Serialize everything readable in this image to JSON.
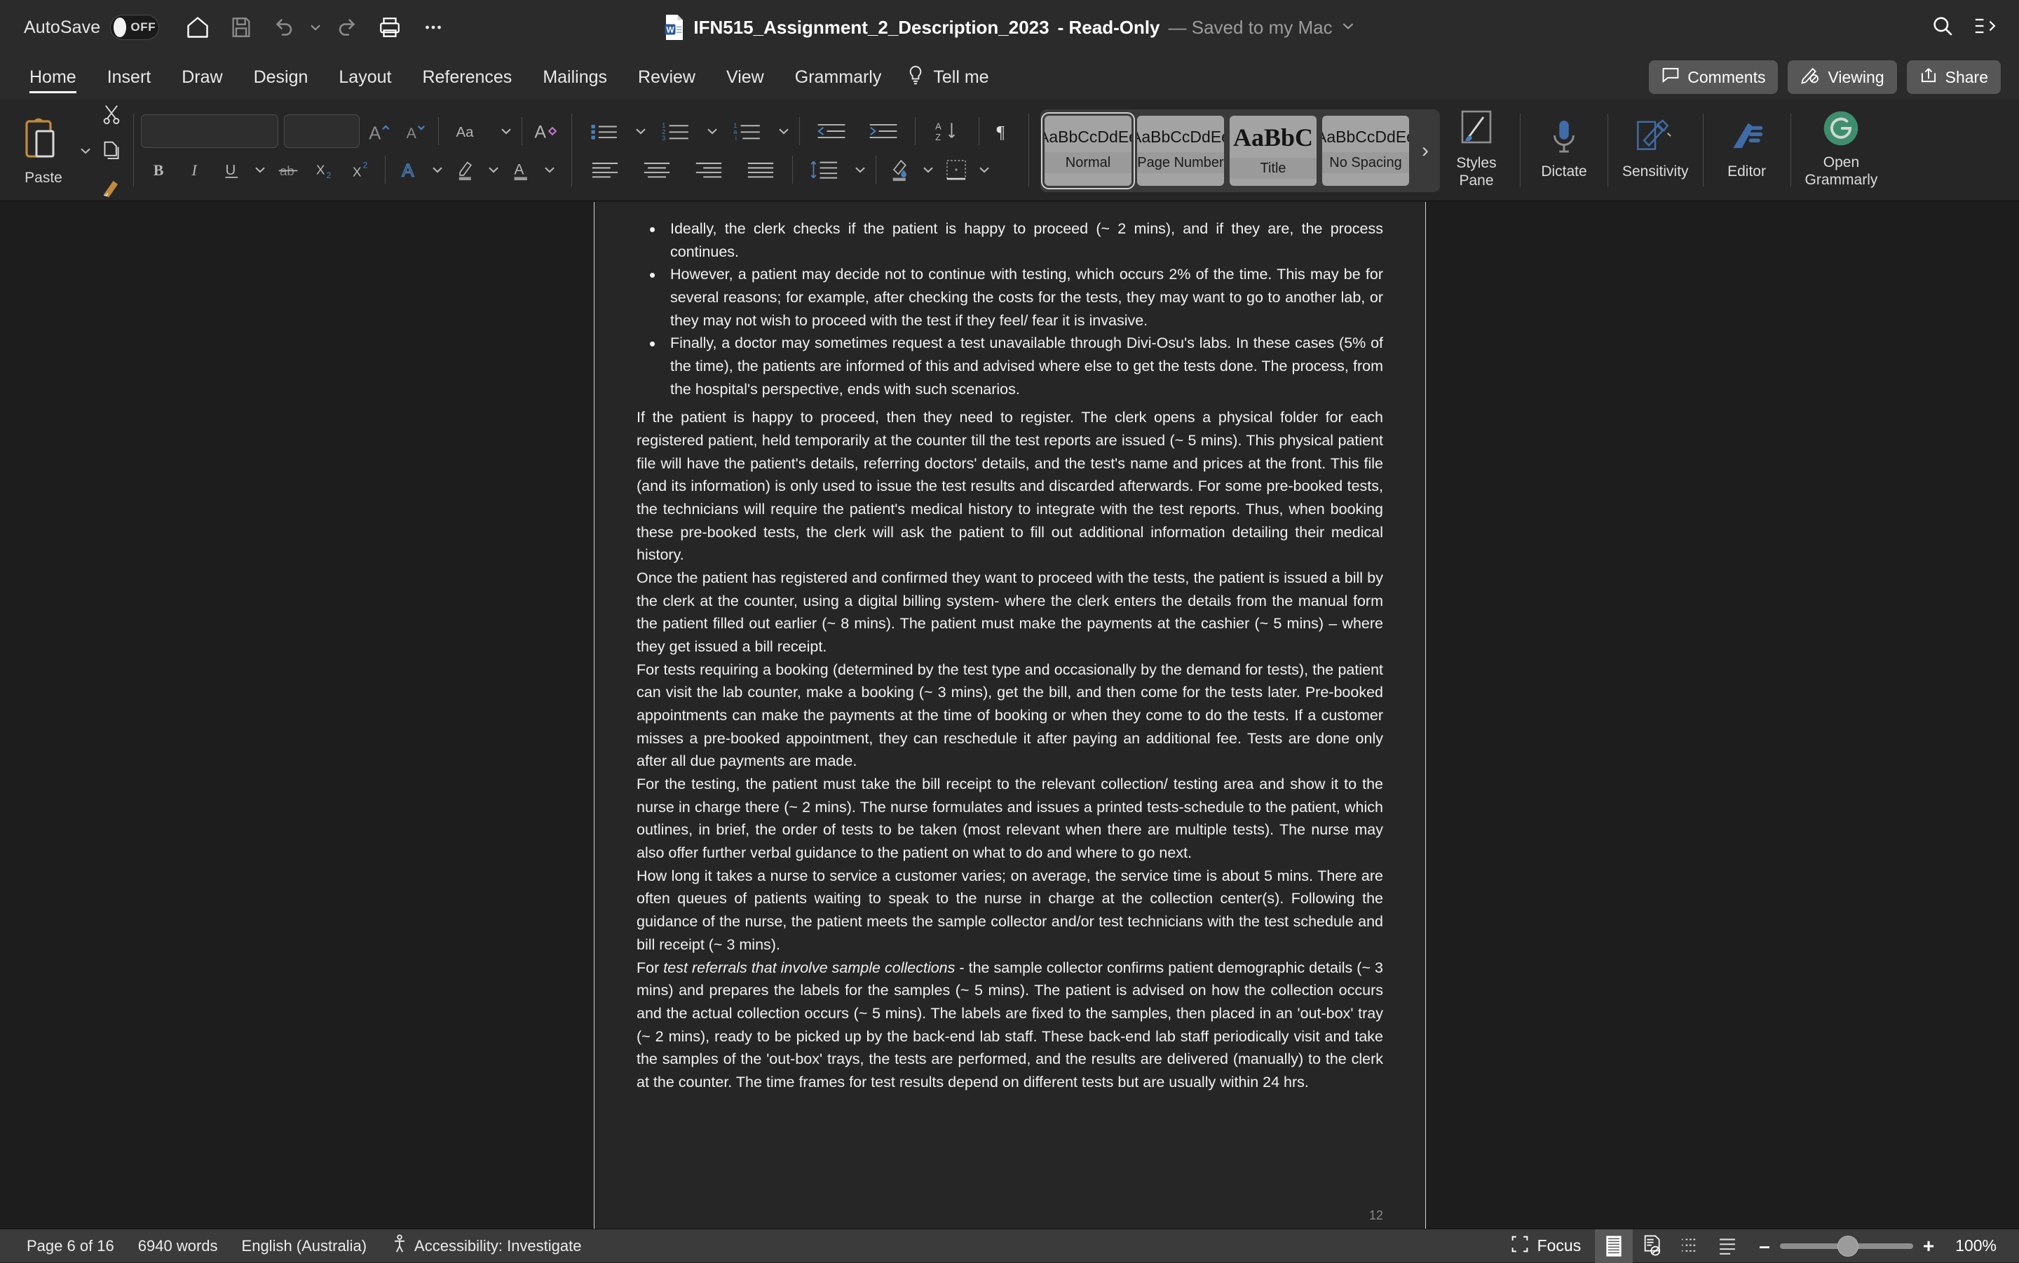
{
  "titlebar": {
    "autosave_label": "AutoSave",
    "autosave_state": "OFF",
    "document_title": "IFN515_Assignment_2_Description_2023",
    "document_mode": "- Read-Only",
    "save_status": "— Saved to my Mac",
    "quick_access": [
      {
        "name": "home-icon"
      },
      {
        "name": "save-icon"
      },
      {
        "name": "undo-icon"
      },
      {
        "name": "redo-icon"
      },
      {
        "name": "print-icon"
      },
      {
        "name": "more-options-icon"
      }
    ],
    "right_icons": [
      {
        "name": "search-icon"
      },
      {
        "name": "ribbon-display-options-icon"
      }
    ]
  },
  "ribbon_tabs": {
    "items": [
      {
        "label": "Home",
        "active": true
      },
      {
        "label": "Insert",
        "active": false
      },
      {
        "label": "Draw",
        "active": false
      },
      {
        "label": "Design",
        "active": false
      },
      {
        "label": "Layout",
        "active": false
      },
      {
        "label": "References",
        "active": false
      },
      {
        "label": "Mailings",
        "active": false
      },
      {
        "label": "Review",
        "active": false
      },
      {
        "label": "View",
        "active": false
      },
      {
        "label": "Grammarly",
        "active": false
      }
    ],
    "tell_me": "Tell me",
    "comments": "Comments",
    "viewing": "Viewing",
    "share": "Share"
  },
  "ribbon": {
    "paste_label": "Paste",
    "font_name": "",
    "font_size": "",
    "styles": [
      {
        "preview": "AaBbCcDdEe",
        "name": "Normal",
        "selected": true,
        "style": "normal"
      },
      {
        "preview": "AaBbCcDdEe",
        "name": "Page Number",
        "selected": false,
        "style": "normal"
      },
      {
        "preview": "AaBbC",
        "name": "Title",
        "selected": false,
        "style": "title"
      },
      {
        "preview": "AaBbCcDdEe",
        "name": "No Spacing",
        "selected": false,
        "style": "normal"
      }
    ],
    "gallery_more": "›",
    "styles_pane_label_1": "Styles",
    "styles_pane_label_2": "Pane",
    "dictate_label": "Dictate",
    "sensitivity_label": "Sensitivity",
    "editor_label": "Editor",
    "grammarly_label_1": "Open",
    "grammarly_label_2": "Grammarly"
  },
  "document": {
    "bullets": [
      "Ideally, the clerk checks if the patient is happy to proceed (~ 2 mins), and if they are, the process continues.",
      "However, a patient may decide not to continue with testing, which occurs 2% of the time. This may be for several reasons; for example, after checking the costs for the tests, they may want to go to another lab, or they may not wish to proceed with the test if they feel/ fear it is invasive.",
      "Finally, a doctor may sometimes request a test unavailable through Divi-Osu's labs. In these cases (5% of the time), the patients are informed of this and advised where else to get the tests done. The process, from the hospital's perspective, ends with such scenarios."
    ],
    "paragraphs": [
      "If the patient is happy to proceed, then they need to register. The clerk opens a physical folder for each registered patient, held temporarily at the counter till the test reports are issued (~ 5 mins). This physical patient file will have the patient's details, referring doctors' details, and the test's name and prices at the front. This file (and its information) is only used to issue the test results and discarded afterwards. For some pre-booked tests, the technicians will require the patient's medical history to integrate with the test reports. Thus, when booking these pre-booked tests, the clerk will ask the patient to fill out additional information detailing their medical history.",
      "Once the patient has registered and confirmed they want to proceed with the tests, the patient is issued a bill by the clerk at the counter, using a digital billing system- where the clerk enters the details from the manual form the patient filled out earlier (~ 8 mins). The patient must make the payments at the cashier (~ 5 mins) – where they get issued a bill receipt.",
      "For tests requiring a booking (determined by the test type and occasionally by the demand for tests), the patient can visit the lab counter, make a booking (~ 3 mins), get the bill, and then come for the tests later. Pre-booked appointments can make the payments at the time of booking or when they come to do the tests. If a customer misses a pre-booked appointment, they can reschedule it after paying an additional fee. Tests are done only after all due payments are made.",
      "For the testing, the patient must take the bill receipt to the relevant collection/ testing area and show it to the nurse in charge there (~ 2 mins). The nurse formulates and issues a printed tests-schedule to the patient, which outlines, in brief, the order of tests to be taken (most relevant when there are multiple tests). The nurse may also offer further verbal guidance to the patient on what to do and where to go next.",
      "How long it takes a nurse to service a customer varies; on average, the service time is about 5 mins. There are often queues of patients waiting to speak to the nurse in charge at the collection center(s). Following the guidance of the nurse, the patient meets the sample collector and/or test technicians with the test schedule and bill receipt (~ 3 mins)."
    ],
    "final_paragraph": {
      "lead": "For ",
      "italic": "test referrals that involve sample collections",
      "rest": " - the sample collector confirms patient demographic details (~ 3 mins) and prepares the labels for the samples (~ 5 mins). The patient is advised on how the collection occurs and the actual collection occurs (~ 5 mins). The labels are fixed to the samples, then placed in an 'out-box' tray (~ 2 mins), ready to be picked up by the back-end lab staff. These back-end lab staff periodically visit and take the samples of the 'out-box' trays, the tests are performed, and the results are delivered (manually) to the clerk at the counter. The time frames for test results depend on different tests but are usually within 24 hrs."
    },
    "page_number_footer": "12"
  },
  "statusbar": {
    "page_indicator": "Page 6 of 16",
    "word_count": "6940 words",
    "language": "English (Australia)",
    "accessibility": "Accessibility: Investigate",
    "focus_label": "Focus",
    "zoom_level": "100%",
    "zoom_out": "–",
    "zoom_in": "+",
    "views": [
      {
        "name": "print-layout-view",
        "active": true
      },
      {
        "name": "web-layout-view",
        "active": false
      },
      {
        "name": "outline-view",
        "active": false
      },
      {
        "name": "draft-view",
        "active": false
      }
    ]
  },
  "colors": {
    "titlebar_bg": "#2b2b2b",
    "ribbon_bg": "#262626",
    "page_bg": "#262626",
    "canvas_bg": "#1d1d1d",
    "statusbar_bg": "#3b3b3b",
    "accent_blue": "#4a7ebb",
    "grammarly_green": "#3e8e6e"
  }
}
